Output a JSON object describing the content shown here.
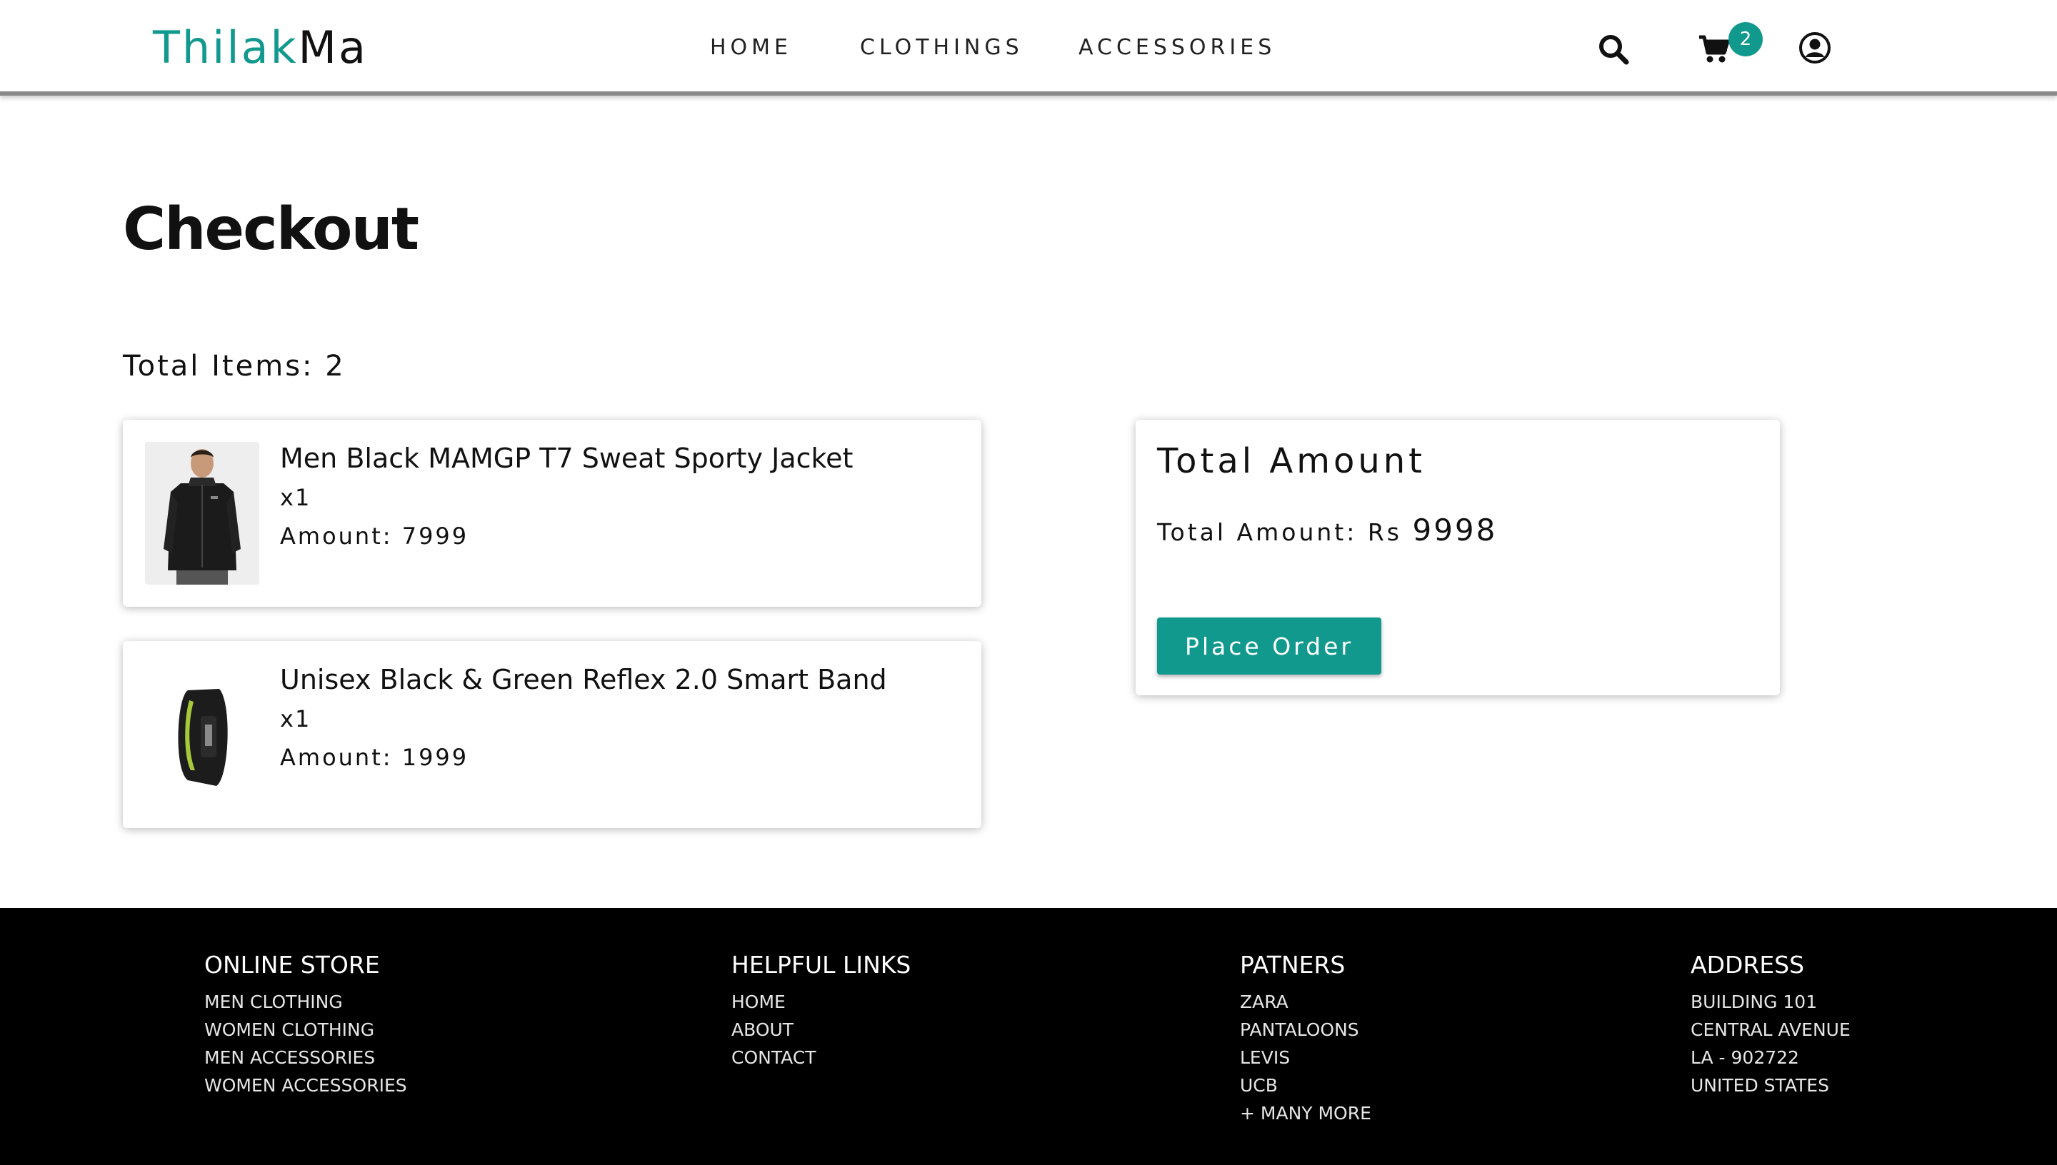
{
  "brand": {
    "part1": "Thilak",
    "part2": "Ma",
    "accent_color": "#11998e"
  },
  "nav": {
    "links": [
      "HOME",
      "CLOTHINGS",
      "ACCESSORIES"
    ]
  },
  "header_icons": {
    "search": "search-icon",
    "cart": "cart-icon",
    "user": "user-circle-icon",
    "cart_count": "2"
  },
  "main": {
    "title": "Checkout",
    "total_items": "Total Items: 2",
    "items": [
      {
        "name": "Men Black MAMGP T7 Sweat Sporty Jacket",
        "qty": "x1",
        "amount": "Amount: 7999",
        "image": "jacket-image"
      },
      {
        "name": "Unisex Black & Green Reflex 2.0 Smart Band",
        "qty": "x1",
        "amount": "Amount: 1999",
        "image": "smart-band-image"
      }
    ]
  },
  "summary": {
    "title": "Total Amount",
    "label": "Total Amount: Rs ",
    "value": "9998",
    "button": "Place Order"
  },
  "footer": {
    "online_store": {
      "heading": "ONLINE STORE",
      "links": [
        "MEN CLOTHING",
        "WOMEN CLOTHING",
        "MEN ACCESSORIES",
        "WOMEN ACCESSORIES"
      ]
    },
    "helpful_links": {
      "heading": "HELPFUL LINKS",
      "links": [
        "HOME",
        "ABOUT",
        "CONTACT"
      ]
    },
    "partners": {
      "heading": "PATNERS",
      "links": [
        "ZARA",
        "PANTALOONS",
        "LEVIS",
        "UCB",
        "+ MANY MORE"
      ]
    },
    "address": {
      "heading": "ADDRESS",
      "lines": [
        "BUILDING 101",
        "CENTRAL AVENUE",
        "LA - 902722",
        "UNITED STATES"
      ]
    }
  }
}
